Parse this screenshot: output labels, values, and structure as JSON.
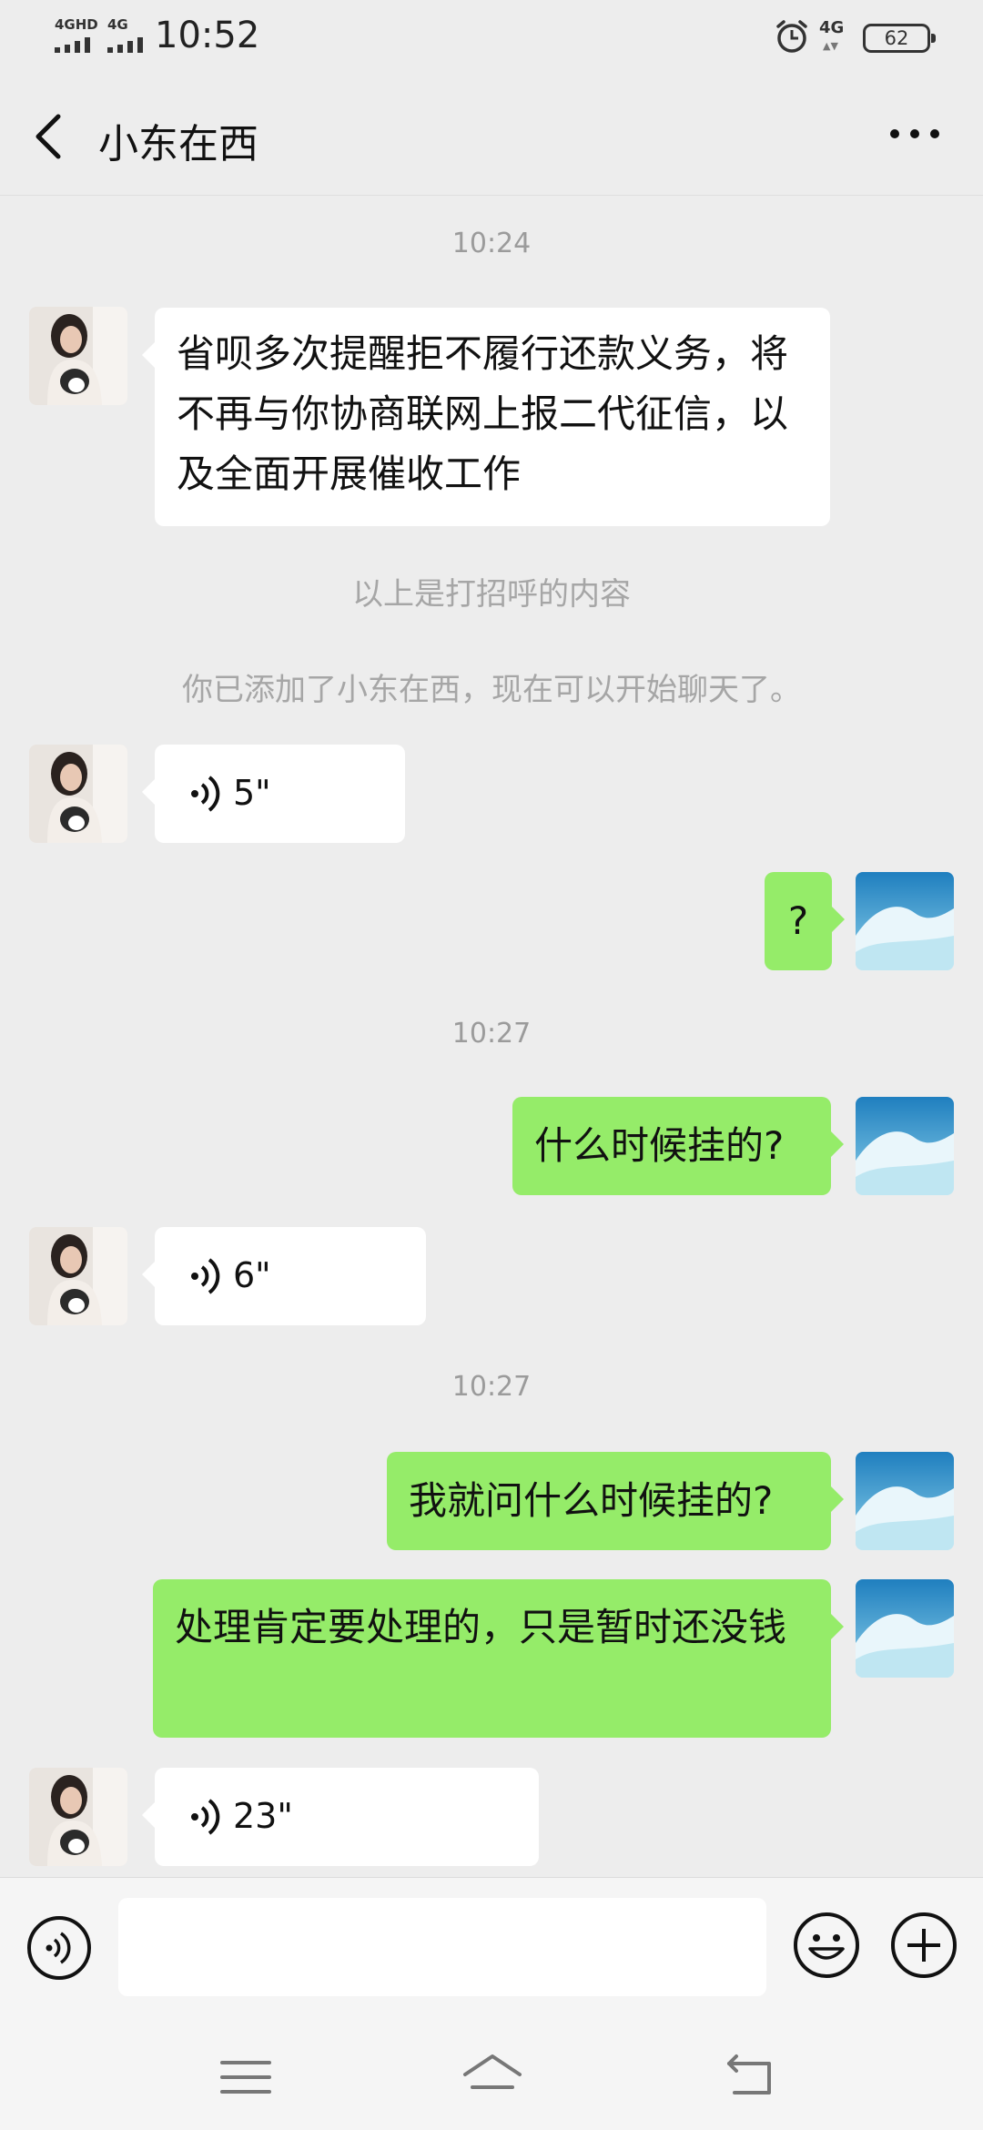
{
  "status_bar": {
    "signal1_label": "4GHD",
    "signal2_label": "4G",
    "time": "10:52",
    "network_label": "4G",
    "battery": "62"
  },
  "header": {
    "title": "小东在西",
    "back_icon": "chevron-left-icon",
    "more_icon": "more-dots-icon"
  },
  "chat": {
    "time1": "10:24",
    "msg1_text": "省呗多次提醒拒不履行还款义务，将不再与你协商联网上报二代征信，以及全面开展催收工作",
    "sys1": "以上是打招呼的内容",
    "sys2": "你已添加了小东在西，现在可以开始聊天了。",
    "voice1": "5\"",
    "msg2_text": "?",
    "time2": "10:27",
    "msg3_text": "什么时候挂的?",
    "voice2": "6\"",
    "time3": "10:27",
    "msg4_text": "我就问什么时候挂的?",
    "msg5_text": "处理肯定要处理的，只是暂时还没钱",
    "voice3": "23\""
  },
  "colors": {
    "background": "#ededed",
    "incoming_bubble": "#ffffff",
    "outgoing_bubble": "#95ec69"
  },
  "input_bar": {
    "voice_icon": "voice-toggle-icon",
    "emoji_icon": "emoji-icon",
    "plus_icon": "plus-icon"
  },
  "nav_bar": {
    "icons": [
      "menu-icon",
      "home-icon",
      "back-icon"
    ]
  }
}
